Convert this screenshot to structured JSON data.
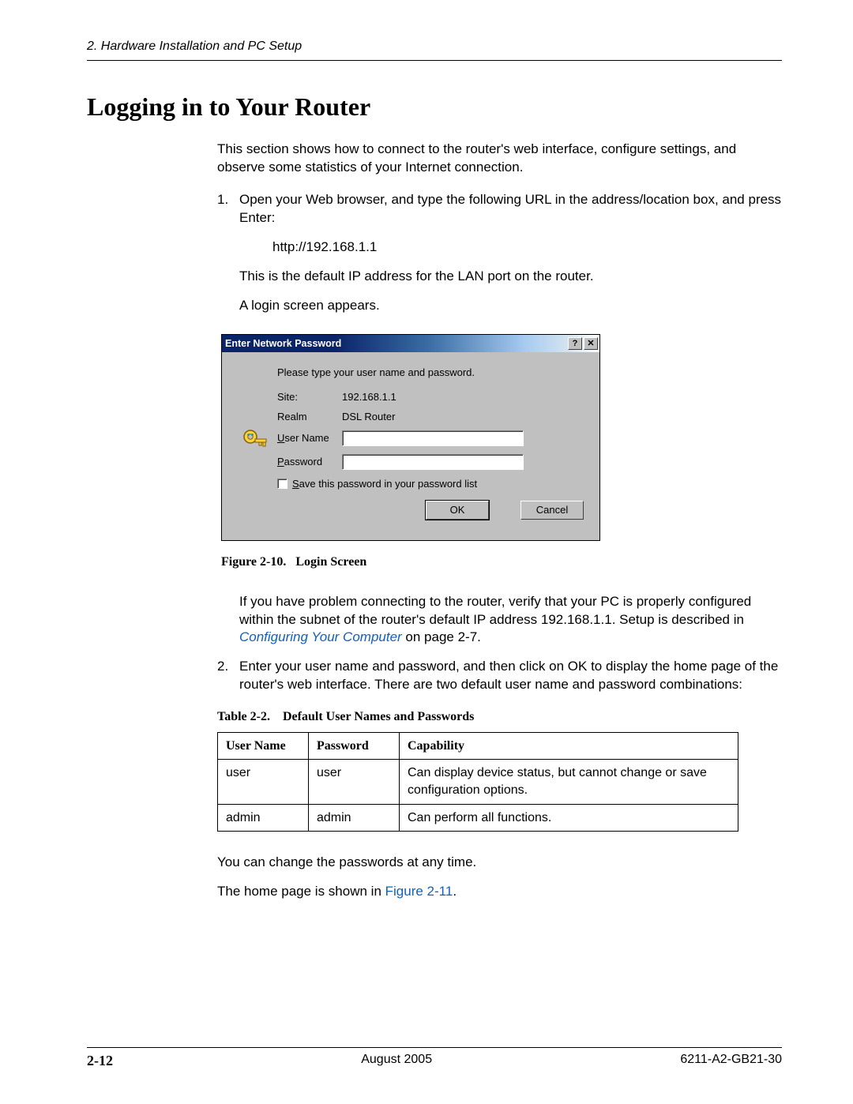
{
  "header": {
    "chapter": "2. Hardware Installation and PC Setup"
  },
  "section": {
    "title": "Logging in to Your Router",
    "intro": "This section shows how to connect to the router's web interface, configure settings, and observe some statistics of your Internet connection."
  },
  "steps": {
    "s1_num": "1.",
    "s1_text": "Open your Web browser, and type the following URL in the address/location box, and press Enter:",
    "s1_url": "http://192.168.1.1",
    "s1_note1": "This is the default IP address for the LAN port on the router.",
    "s1_note2": "A login screen appears.",
    "s1_after_fig_a": "If you have problem connecting to the router, verify that your PC is properly configured within the subnet of the router's default IP address 192.168.1.1. Setup is described in ",
    "s1_after_fig_link": "Configuring Your Computer",
    "s1_after_fig_b": " on page 2-7.",
    "s2_num": "2.",
    "s2_text": "Enter your user name and password, and then click on OK to display the home page of the router's web interface. There are two default user name and password combinations:"
  },
  "dialog": {
    "title": "Enter Network Password",
    "help_label": "?",
    "close_label": "✕",
    "prompt": "Please type your user name and password.",
    "site_label": "Site:",
    "site_value": "192.168.1.1",
    "realm_label": "Realm",
    "realm_value": "DSL Router",
    "user_label": "User Name",
    "pass_label": "Password",
    "save_label": "Save this password in your password list",
    "ok_label": "OK",
    "cancel_label": "Cancel"
  },
  "figure": {
    "num": "Figure 2-10.",
    "title": "Login Screen"
  },
  "table": {
    "caption_num": "Table 2-2.",
    "caption_title": "Default User Names and Passwords",
    "headers": {
      "user": "User Name",
      "pass": "Password",
      "cap": "Capability"
    },
    "rows": [
      {
        "user": "user",
        "pass": "user",
        "cap": "Can display device status, but cannot change or save configuration options."
      },
      {
        "user": "admin",
        "pass": "admin",
        "cap": "Can perform all functions."
      }
    ]
  },
  "closing": {
    "p1": "You can change the passwords at any time.",
    "p2a": "The home page is shown in ",
    "p2_link": "Figure 2-11",
    "p2b": "."
  },
  "footer": {
    "page": "2-12",
    "date": "August 2005",
    "docnum": "6211-A2-GB21-30"
  }
}
